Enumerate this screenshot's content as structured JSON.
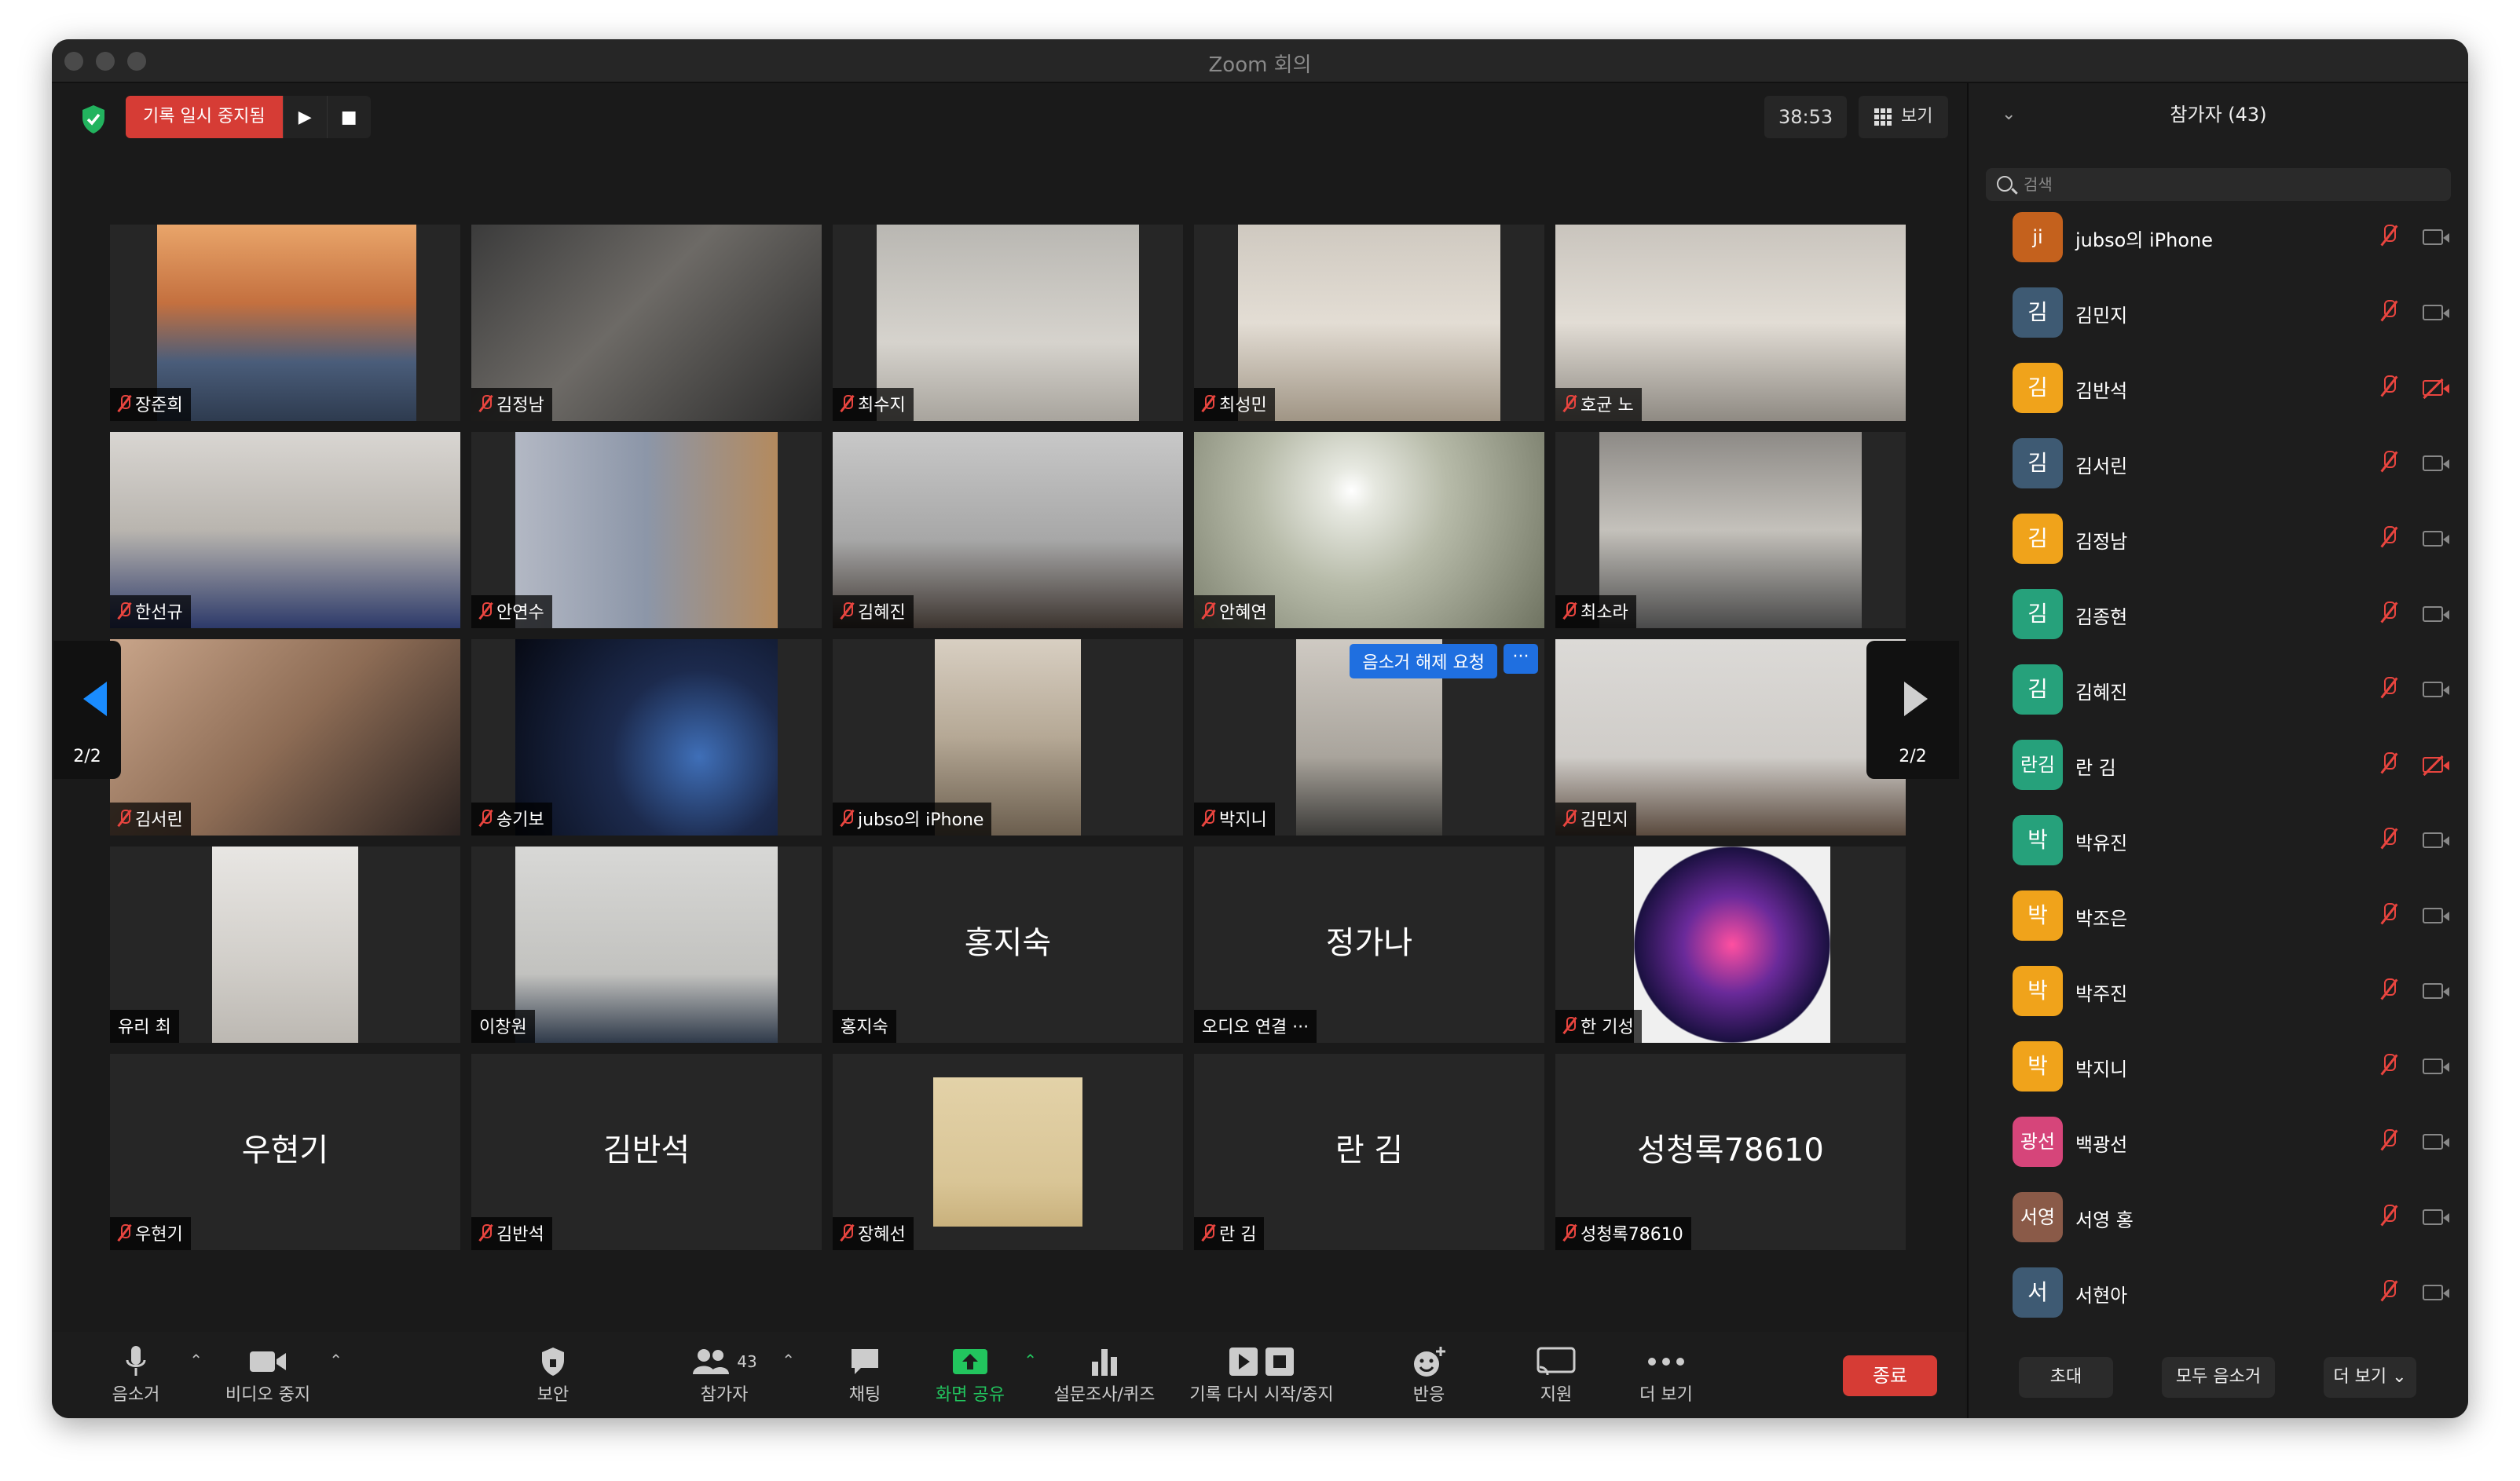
{
  "window": {
    "title": "Zoom 회의"
  },
  "recording": {
    "label": "기록 일시 중지됨",
    "play": "▶",
    "stop": "■"
  },
  "timer": "38:53",
  "view_label": "보기",
  "page_indicator": "2/2",
  "tiles": [
    {
      "name": "장준희",
      "muted": true,
      "video": true
    },
    {
      "name": "김정남",
      "muted": true,
      "video": true
    },
    {
      "name": "최수지",
      "muted": true,
      "video": true
    },
    {
      "name": "최성민",
      "muted": true,
      "video": true
    },
    {
      "name": "호균 노",
      "muted": true,
      "video": true
    },
    {
      "name": "한선규",
      "muted": true,
      "video": true
    },
    {
      "name": "안연수",
      "muted": true,
      "video": true
    },
    {
      "name": "김혜진",
      "muted": true,
      "video": true
    },
    {
      "name": "안혜연",
      "muted": true,
      "video": true
    },
    {
      "name": "최소라",
      "muted": true,
      "video": true
    },
    {
      "name": "김서린",
      "muted": true,
      "video": true
    },
    {
      "name": "송기보",
      "muted": true,
      "video": true
    },
    {
      "name": "jubso의 iPhone",
      "muted": true,
      "video": true
    },
    {
      "name": "박지니",
      "muted": true,
      "video": true,
      "unmute_request": "음소거 해제 요청",
      "more": "···"
    },
    {
      "name": "김민지",
      "muted": true,
      "video": true
    },
    {
      "name": "유리 최",
      "muted": false,
      "video": true
    },
    {
      "name": "이창원",
      "muted": false,
      "video": true
    },
    {
      "name": "홍지숙",
      "muted": false,
      "video": false,
      "display": "홍지숙"
    },
    {
      "name": "오디오 연결 ···",
      "muted": false,
      "video": false,
      "display": "정가나"
    },
    {
      "name": "한 기성",
      "muted": true,
      "video": true
    },
    {
      "name": "우현기",
      "muted": true,
      "video": false,
      "display": "우현기"
    },
    {
      "name": "김반석",
      "muted": true,
      "video": false,
      "display": "김반석"
    },
    {
      "name": "장혜선",
      "muted": true,
      "video": true
    },
    {
      "name": "란 김",
      "muted": true,
      "video": false,
      "display": "란 김"
    },
    {
      "name": "성청록78610",
      "muted": true,
      "video": false,
      "display": "성청록78610"
    }
  ],
  "toolbar": {
    "mute": "음소거",
    "video": "비디오 중지",
    "security": "보안",
    "participants": "참가자",
    "participants_count": "43",
    "chat": "채팅",
    "share": "화면 공유",
    "polls": "설문조사/퀴즈",
    "record": "기록 다시 시작/중지",
    "reactions": "반응",
    "support": "지원",
    "more": "더 보기",
    "end": "종료"
  },
  "panel": {
    "title": "참가자 (43)",
    "search_placeholder": "검색",
    "participants": [
      {
        "avatar": "ji",
        "name": "jubso의 iPhone",
        "color": "#c4611d",
        "cam_off": false
      },
      {
        "avatar": "김",
        "name": "김민지",
        "color": "#3e5a73",
        "cam_off": false
      },
      {
        "avatar": "김",
        "name": "김반석",
        "color": "#f0a31b",
        "cam_off": true
      },
      {
        "avatar": "김",
        "name": "김서린",
        "color": "#3e5a73",
        "cam_off": false
      },
      {
        "avatar": "김",
        "name": "김정남",
        "color": "#f0a31b",
        "cam_off": false
      },
      {
        "avatar": "김",
        "name": "김종현",
        "color": "#26a17b",
        "cam_off": false
      },
      {
        "avatar": "김",
        "name": "김혜진",
        "color": "#26a17b",
        "cam_off": false
      },
      {
        "avatar": "란김",
        "name": "란 김",
        "color": "#26a17b",
        "cam_off": true
      },
      {
        "avatar": "박",
        "name": "박유진",
        "color": "#26a17b",
        "cam_off": false
      },
      {
        "avatar": "박",
        "name": "박조은",
        "color": "#f0a31b",
        "cam_off": false
      },
      {
        "avatar": "박",
        "name": "박주진",
        "color": "#f0a31b",
        "cam_off": false
      },
      {
        "avatar": "박",
        "name": "박지니",
        "color": "#f0a31b",
        "cam_off": false
      },
      {
        "avatar": "광선",
        "name": "백광선",
        "color": "#d6457a",
        "cam_off": false
      },
      {
        "avatar": "서영",
        "name": "서영 홍",
        "color": "#8a5a48",
        "cam_off": false
      },
      {
        "avatar": "서",
        "name": "서현아",
        "color": "#3e5a73",
        "cam_off": false
      }
    ],
    "invite": "초대",
    "mute_all": "모두 음소거",
    "more": "더 보기"
  }
}
